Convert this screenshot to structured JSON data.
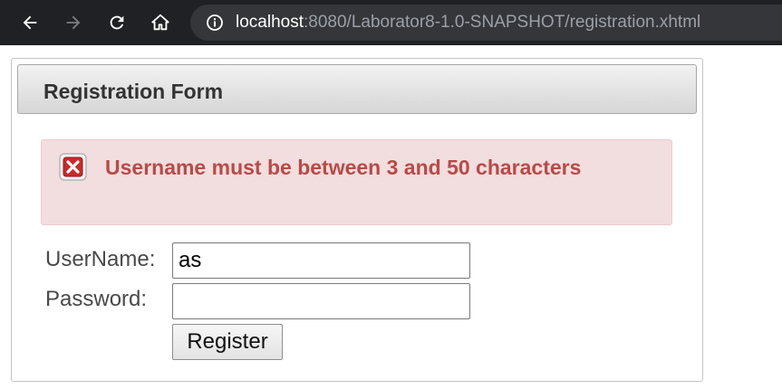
{
  "browser": {
    "url_host": "localhost",
    "url_rest": ":8080/Laborator8-1.0-SNAPSHOT/registration.xhtml",
    "icons": [
      "back-arrow-icon",
      "forward-arrow-icon",
      "reload-icon",
      "home-icon",
      "info-icon"
    ],
    "colors": {
      "toolbar_bg": "#202124",
      "omnibox_bg": "#35363a"
    }
  },
  "form": {
    "title": "Registration Form",
    "error_message": "Username must be between 3 and 50 characters",
    "username_label": "UserName:",
    "username_value": "as",
    "password_label": "Password:",
    "password_value": "",
    "register_label": "Register",
    "colors": {
      "error_text": "#b94a48",
      "error_bg": "#f2dede"
    }
  }
}
